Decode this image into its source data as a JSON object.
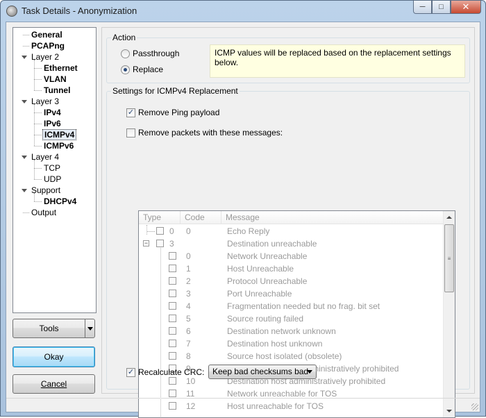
{
  "window": {
    "title": "Task Details - Anonymization"
  },
  "tree": {
    "items": [
      {
        "label": "General",
        "bold": true,
        "level": 0
      },
      {
        "label": "PCAPng",
        "bold": true,
        "level": 0
      },
      {
        "label": "Layer 2",
        "bold": false,
        "level": 0,
        "expanded": true
      },
      {
        "label": "Ethernet",
        "bold": true,
        "level": 1
      },
      {
        "label": "VLAN",
        "bold": true,
        "level": 1
      },
      {
        "label": "Tunnel",
        "bold": true,
        "level": 1
      },
      {
        "label": "Layer 3",
        "bold": false,
        "level": 0,
        "expanded": true
      },
      {
        "label": "IPv4",
        "bold": true,
        "level": 1
      },
      {
        "label": "IPv6",
        "bold": true,
        "level": 1
      },
      {
        "label": "ICMPv4",
        "bold": true,
        "level": 1,
        "selected": true
      },
      {
        "label": "ICMPv6",
        "bold": true,
        "level": 1
      },
      {
        "label": "Layer 4",
        "bold": false,
        "level": 0,
        "expanded": true
      },
      {
        "label": "TCP",
        "bold": false,
        "level": 1
      },
      {
        "label": "UDP",
        "bold": false,
        "level": 1
      },
      {
        "label": "Support",
        "bold": false,
        "level": 0,
        "expanded": true
      },
      {
        "label": "DHCPv4",
        "bold": true,
        "level": 1
      },
      {
        "label": "Output",
        "bold": false,
        "level": 0
      }
    ]
  },
  "buttons": {
    "tools": "Tools",
    "okay": "Okay",
    "cancel": "Cancel"
  },
  "action": {
    "title": "Action",
    "passthrough": "Passthrough",
    "replace": "Replace",
    "selected": "replace",
    "info": "ICMP values will be replaced based on the replacement settings below."
  },
  "settings": {
    "title": "Settings for ICMPv4 Replacement",
    "remove_ping_payload": "Remove Ping payload",
    "remove_ping_payload_checked": true,
    "remove_packets": "Remove packets with these messages:",
    "remove_packets_checked": false
  },
  "table": {
    "columns": [
      "Type",
      "Code",
      "Message"
    ],
    "rows": [
      {
        "type": "0",
        "code": "0",
        "message": "Echo Reply",
        "child": false,
        "group": false
      },
      {
        "type": "3",
        "code": "",
        "message": "Destination unreachable",
        "child": false,
        "group": true
      },
      {
        "type": "",
        "code": "0",
        "message": "Network Unreachable",
        "child": true
      },
      {
        "type": "",
        "code": "1",
        "message": "Host Unreachable",
        "child": true
      },
      {
        "type": "",
        "code": "2",
        "message": "Protocol Unreachable",
        "child": true
      },
      {
        "type": "",
        "code": "3",
        "message": "Port Unreachable",
        "child": true
      },
      {
        "type": "",
        "code": "4",
        "message": "Fragmentation needed but no frag. bit set",
        "child": true
      },
      {
        "type": "",
        "code": "5",
        "message": "Source routing failed",
        "child": true
      },
      {
        "type": "",
        "code": "6",
        "message": "Destination network unknown",
        "child": true
      },
      {
        "type": "",
        "code": "7",
        "message": "Destination host unknown",
        "child": true
      },
      {
        "type": "",
        "code": "8",
        "message": "Source host isolated (obsolete)",
        "child": true
      },
      {
        "type": "",
        "code": "9",
        "message": "Destination network administratively prohibited",
        "child": true
      },
      {
        "type": "",
        "code": "10",
        "message": "Destination host administratively prohibited",
        "child": true
      },
      {
        "type": "",
        "code": "11",
        "message": "Network unreachable for TOS",
        "child": true
      },
      {
        "type": "",
        "code": "12",
        "message": "Host unreachable for TOS",
        "child": true
      }
    ]
  },
  "crc": {
    "label": "Recalculate CRC:",
    "checked": true,
    "option": "Keep bad checksums bad"
  }
}
